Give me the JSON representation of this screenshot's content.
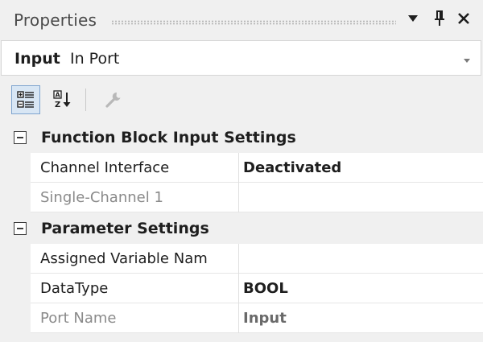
{
  "window": {
    "title": "Properties",
    "dropdown_icon": "triangle-down-icon",
    "pin_icon": "pin-icon",
    "close_icon": "close-icon"
  },
  "selector": {
    "kind": "Input",
    "name": "In Port"
  },
  "toolbar": {
    "categorized_icon": "categorized-view-icon",
    "alphabetical_icon": "alphabetical-sort-icon",
    "property_pages_icon": "wrench-icon"
  },
  "grid": {
    "categories": [
      {
        "label": "Function Block Input Settings",
        "expanded": true,
        "properties": [
          {
            "name": "Channel Interface",
            "value": "Deactivated",
            "enabled": true
          },
          {
            "name": "Single-Channel 1",
            "value": "",
            "enabled": false
          }
        ]
      },
      {
        "label": "Parameter Settings",
        "expanded": true,
        "properties": [
          {
            "name": "Assigned Variable Nam",
            "value": "",
            "enabled": true
          },
          {
            "name": "DataType",
            "value": "BOOL",
            "enabled": true
          },
          {
            "name": "Port Name",
            "value": "Input",
            "enabled": false
          }
        ]
      }
    ]
  },
  "colors": {
    "panel_bg": "#f0f0f0",
    "row_bg": "#ffffff",
    "selected_tool_bg": "#d8e6f4",
    "selected_tool_border": "#7ea4cf",
    "disabled_text": "#8a8a8a"
  }
}
